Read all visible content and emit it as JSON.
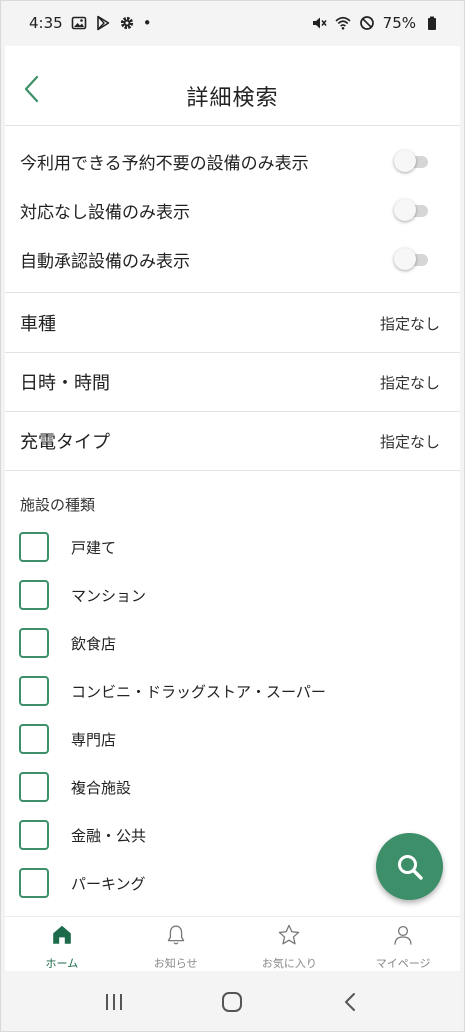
{
  "status_bar": {
    "time": "4:35",
    "dot": "•",
    "battery": "75%",
    "left_icons": [
      "image-icon",
      "play-store-icon",
      "settings-gear-icon"
    ],
    "right_icons": [
      "mute-icon",
      "wifi-icon",
      "do-not-disturb-icon",
      "battery-icon"
    ]
  },
  "header": {
    "title": "詳細検索",
    "back_icon": "chevron-left-icon"
  },
  "toggles": [
    {
      "label": "今利用できる予約不要の設備のみ表示",
      "on": false
    },
    {
      "label": "対応なし設備のみ表示",
      "on": false
    },
    {
      "label": "自動承認設備のみ表示",
      "on": false
    }
  ],
  "filters": [
    {
      "label": "車種",
      "value": "指定なし"
    },
    {
      "label": "日時・時間",
      "value": "指定なし"
    },
    {
      "label": "充電タイプ",
      "value": "指定なし"
    }
  ],
  "facility": {
    "title": "施設の種類",
    "options": [
      {
        "label": "戸建て",
        "checked": false
      },
      {
        "label": "マンション",
        "checked": false
      },
      {
        "label": "飲食店",
        "checked": false
      },
      {
        "label": "コンビニ・ドラッグストア・スーパー",
        "checked": false
      },
      {
        "label": "専門店",
        "checked": false
      },
      {
        "label": "複合施設",
        "checked": false
      },
      {
        "label": "金融・公共",
        "checked": false
      },
      {
        "label": "パーキング",
        "checked": false
      }
    ]
  },
  "fab": {
    "icon": "search-icon"
  },
  "bottom_nav": {
    "items": [
      {
        "label": "ホーム",
        "icon": "home-icon",
        "active": true
      },
      {
        "label": "お知らせ",
        "icon": "bell-icon",
        "active": false
      },
      {
        "label": "お気に入り",
        "icon": "star-icon",
        "active": false
      },
      {
        "label": "マイページ",
        "icon": "person-icon",
        "active": false
      }
    ]
  },
  "system_nav": {
    "icons": [
      "recent-apps-icon",
      "home-circle-icon",
      "back-icon"
    ]
  },
  "colors": {
    "accent": "#3c8f68",
    "active_nav": "#1d6b4a",
    "divider": "#e3e3e3"
  }
}
